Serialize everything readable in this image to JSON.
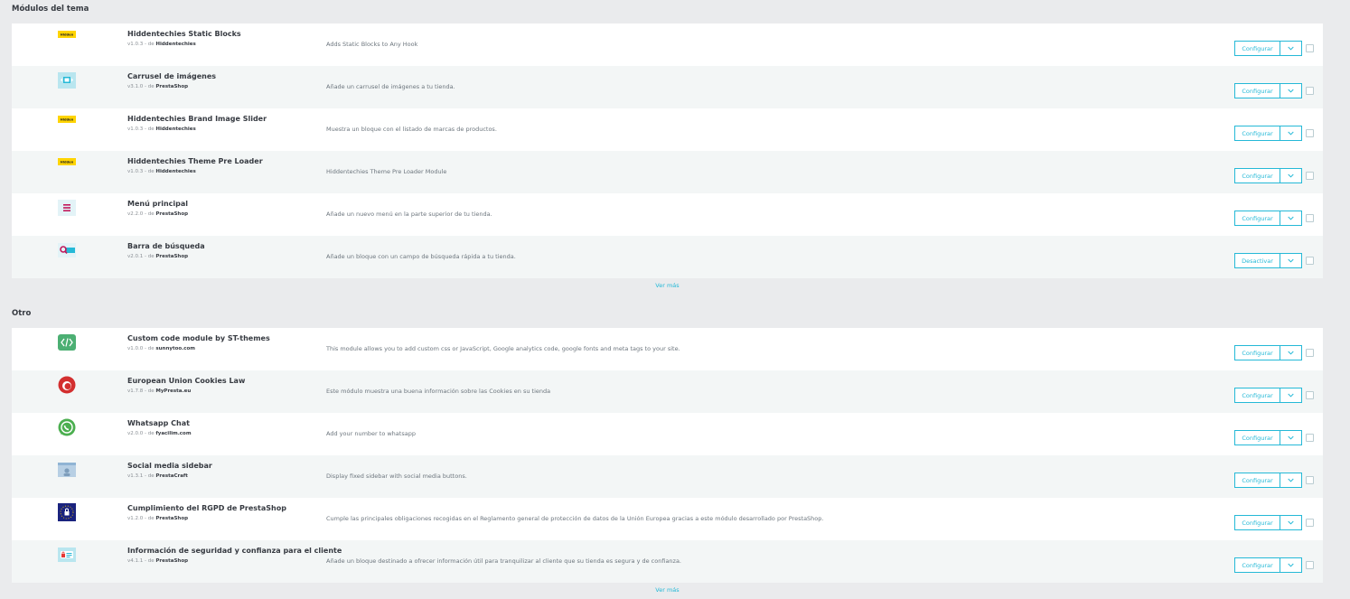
{
  "sections": [
    {
      "title": "Módulos del tema",
      "see_more": "Ver más",
      "modules": [
        {
          "name": "Hiddentechies Static Blocks",
          "version": "v1.0.3",
          "by": "- de",
          "author": "Hiddentechies",
          "description": "Adds Static Blocks to Any Hook",
          "action": "Configurar",
          "icon": "hiddentechies-logo-icon"
        },
        {
          "name": "Carrusel de imágenes",
          "version": "v3.1.0",
          "by": "- de",
          "author": "PrestaShop",
          "description": "Añade un carrusel de imágenes a tu tienda.",
          "action": "Configurar",
          "icon": "image-slider-icon"
        },
        {
          "name": "Hiddentechies Brand Image Slider",
          "version": "v1.0.3",
          "by": "- de",
          "author": "Hiddentechies",
          "description": "Muestra un bloque con el listado de marcas de productos.",
          "action": "Configurar",
          "icon": "hiddentechies-logo-icon"
        },
        {
          "name": "Hiddentechies Theme Pre Loader",
          "version": "v1.0.3",
          "by": "- de",
          "author": "Hiddentechies",
          "description": "Hiddentechies Theme Pre Loader Module",
          "action": "Configurar",
          "icon": "hiddentechies-logo-icon"
        },
        {
          "name": "Menú principal",
          "version": "v2.2.0",
          "by": "- de",
          "author": "PrestaShop",
          "description": "Añade un nuevo menú en la parte superior de tu tienda.",
          "action": "Configurar",
          "icon": "menu-icon"
        },
        {
          "name": "Barra de búsqueda",
          "version": "v2.0.1",
          "by": "- de",
          "author": "PrestaShop",
          "description": "Añade un bloque con un campo de búsqueda rápida a tu tienda.",
          "action": "Desactivar",
          "icon": "search-bar-icon"
        }
      ]
    },
    {
      "title": "Otro",
      "see_more": "Ver más",
      "modules": [
        {
          "name": "Custom code module by ST-themes",
          "version": "v1.0.0",
          "by": "- de",
          "author": "sunnytoo.com",
          "description": "This module allows you to add custom css or JavaScript, Google analytics code, google fonts and meta tags to your site.",
          "action": "Configurar",
          "icon": "code-icon"
        },
        {
          "name": "European Union Cookies Law",
          "version": "v1.7.8",
          "by": "- de",
          "author": "MyPresta.eu",
          "description": "Este módulo muestra una buena información sobre las Cookies en su tienda",
          "action": "Configurar",
          "icon": "mypresta-logo-icon"
        },
        {
          "name": "Whatsapp Chat",
          "version": "v2.0.0",
          "by": "- de",
          "author": "fyacilim.com",
          "description": "Add your number to whatsapp",
          "action": "Configurar",
          "icon": "whatsapp-icon"
        },
        {
          "name": "Social media sidebar",
          "version": "v1.3.1",
          "by": "- de",
          "author": "PrestaCraft",
          "description": "Display fixed sidebar with social media buttons.",
          "action": "Configurar",
          "icon": "folder-icon"
        },
        {
          "name": "Cumplimiento del RGPD de PrestaShop",
          "version": "v1.2.0",
          "by": "- de",
          "author": "PrestaShop",
          "description": "Cumple las principales obligaciones recogidas en el Reglamento general de protección de datos de la Unión Europea gracias a este módulo desarrollado por PrestaShop.",
          "action": "Configurar",
          "icon": "gdpr-lock-icon"
        },
        {
          "name": "Información de seguridad y confianza para el cliente",
          "version": "v4.1.1",
          "by": "- de",
          "author": "PrestaShop",
          "description": "Añade un bloque destinado a ofrecer información útil para tranquilizar al cliente que su tienda es segura y de confianza.",
          "action": "Configurar",
          "icon": "reassurance-icon"
        }
      ]
    }
  ],
  "colors": {
    "accent": "#25b9d7",
    "hiddentechies_yellow": "#ffd400",
    "whatsapp_green": "#4caf50"
  }
}
